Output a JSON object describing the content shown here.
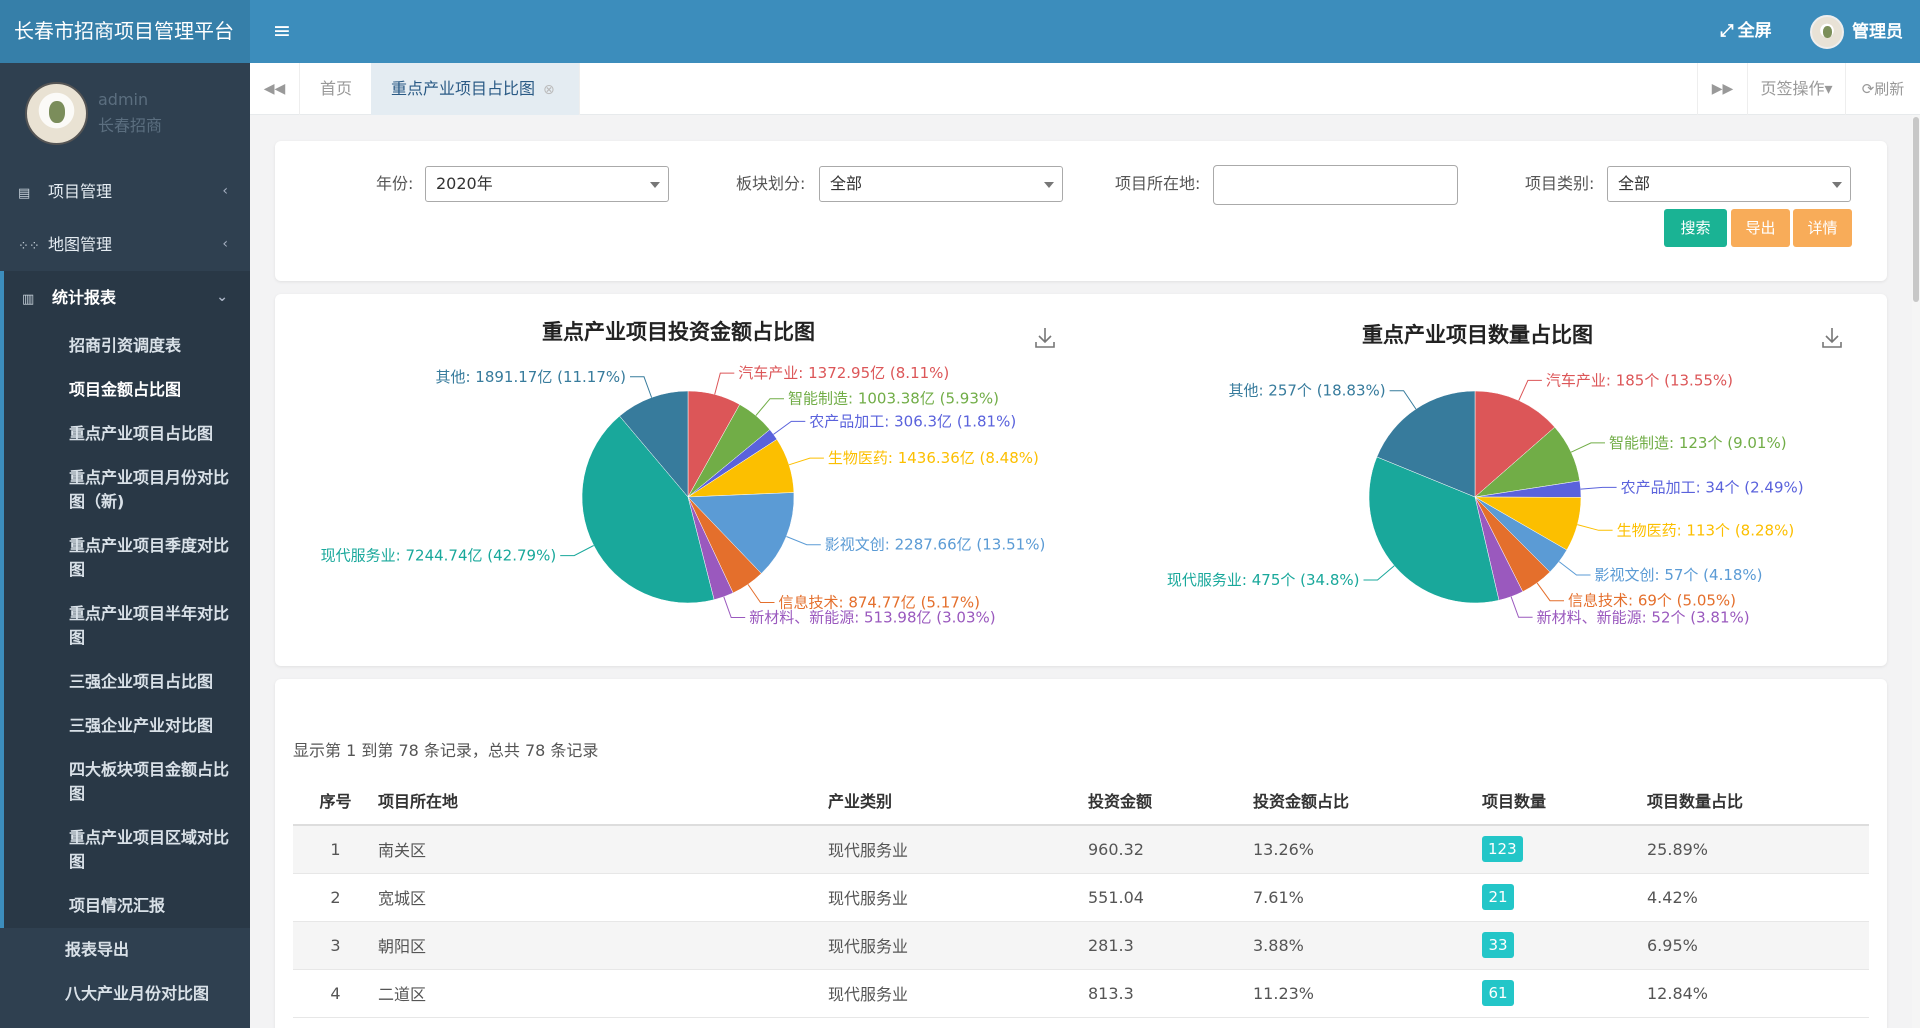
{
  "app": {
    "title": "长春市招商项目管理平台",
    "fullscreen_label": "全屏",
    "user_label": "管理员"
  },
  "sidebar": {
    "user": {
      "name": "admin",
      "org": "长春招商"
    },
    "top_items": [
      {
        "label": "项目管理"
      },
      {
        "label": "地图管理"
      }
    ],
    "active_group": {
      "label": "统计报表",
      "items": [
        {
          "label": "招商引资调度表"
        },
        {
          "label": "项目金额占比图"
        },
        {
          "label": "重点产业项目占比图"
        },
        {
          "label": "重点产业项目月份对比图（新)"
        },
        {
          "label": "重点产业项目季度对比图"
        },
        {
          "label": "重点产业项目半年对比图"
        },
        {
          "label": "三强企业项目占比图"
        },
        {
          "label": "三强企业产业对比图"
        },
        {
          "label": "四大板块项目金额占比图"
        },
        {
          "label": "重点产业项目区域对比图"
        },
        {
          "label": "项目情况汇报"
        },
        {
          "label": "报表导出"
        },
        {
          "label": "八大产业月份对比图"
        }
      ]
    }
  },
  "tabs": {
    "items": [
      {
        "label": "首页"
      },
      {
        "label": "重点产业项目占比图"
      }
    ],
    "ops_label": "页签操作",
    "refresh_label": "刷新"
  },
  "filters": {
    "year_label": "年份:",
    "year_value": "2020年",
    "block_label": "板块划分:",
    "block_value": "全部",
    "location_label": "项目所在地:",
    "location_value": "",
    "category_label": "项目类别:",
    "category_value": "全部",
    "search_label": "搜索",
    "export_label": "导出",
    "detail_label": "详情"
  },
  "chart_data": [
    {
      "type": "pie",
      "title": "重点产业项目投资金额占比图",
      "slices": [
        {
          "name": "汽车产业",
          "value": 1372.95,
          "label": "汽车产业: 1372.95亿 (8.11%)",
          "color": "#dc5658"
        },
        {
          "name": "智能制造",
          "value": 1003.38,
          "label": "智能制造: 1003.38亿 (5.93%)",
          "color": "#71ad47"
        },
        {
          "name": "农产品加工",
          "value": 306.3,
          "label": "农产品加工: 306.3亿 (1.81%)",
          "color": "#5a62dc"
        },
        {
          "name": "生物医药",
          "value": 1436.36,
          "label": "生物医药: 1436.36亿 (8.48%)",
          "color": "#fcbf00"
        },
        {
          "name": "影视文创",
          "value": 2287.66,
          "label": "影视文创: 2287.66亿 (13.51%)",
          "color": "#5b9bd5"
        },
        {
          "name": "信息技术",
          "value": 874.77,
          "label": "信息技术: 874.77亿 (5.17%)",
          "color": "#e46f2c"
        },
        {
          "name": "新材料、新能源",
          "value": 513.98,
          "label": "新材料、新能源: 513.98亿 (3.03%)",
          "color": "#9a59be"
        },
        {
          "name": "现代服务业",
          "value": 7244.74,
          "label": "现代服务业: 7244.74亿 (42.79%)",
          "color": "#19a89b"
        },
        {
          "name": "其他",
          "value": 1891.17,
          "label": "其他: 1891.17亿 (11.17%)",
          "color": "#377b9c"
        }
      ]
    },
    {
      "type": "pie",
      "title": "重点产业项目数量占比图",
      "slices": [
        {
          "name": "汽车产业",
          "value": 185,
          "label": "汽车产业: 185个 (13.55%)",
          "color": "#dc5658"
        },
        {
          "name": "智能制造",
          "value": 123,
          "label": "智能制造: 123个 (9.01%)",
          "color": "#71ad47"
        },
        {
          "name": "农产品加工",
          "value": 34,
          "label": "农产品加工: 34个 (2.49%)",
          "color": "#5a62dc"
        },
        {
          "name": "生物医药",
          "value": 113,
          "label": "生物医药: 113个 (8.28%)",
          "color": "#fcbf00"
        },
        {
          "name": "影视文创",
          "value": 57,
          "label": "影视文创: 57个 (4.18%)",
          "color": "#5b9bd5"
        },
        {
          "name": "信息技术",
          "value": 69,
          "label": "信息技术: 69个 (5.05%)",
          "color": "#e46f2c"
        },
        {
          "name": "新材料、新能源",
          "value": 52,
          "label": "新材料、新能源: 52个 (3.81%)",
          "color": "#9a59be"
        },
        {
          "name": "现代服务业",
          "value": 475,
          "label": "现代服务业: 475个 (34.8%)",
          "color": "#19a89b"
        },
        {
          "name": "其他",
          "value": 257,
          "label": "其他: 257个 (18.83%)",
          "color": "#377b9c"
        }
      ]
    }
  ],
  "table": {
    "records_info": "显示第 1 到第 78 条记录，总共 78 条记录",
    "headers": [
      "序号",
      "项目所在地",
      "产业类别",
      "投资金额",
      "投资金额占比",
      "项目数量",
      "项目数量占比"
    ],
    "rows": [
      [
        "1",
        "南关区",
        "现代服务业",
        "960.32",
        "13.26%",
        "123",
        "25.89%"
      ],
      [
        "2",
        "宽城区",
        "现代服务业",
        "551.04",
        "7.61%",
        "21",
        "4.42%"
      ],
      [
        "3",
        "朝阳区",
        "现代服务业",
        "281.3",
        "3.88%",
        "33",
        "6.95%"
      ],
      [
        "4",
        "二道区",
        "现代服务业",
        "813.3",
        "11.23%",
        "61",
        "12.84%"
      ]
    ]
  }
}
